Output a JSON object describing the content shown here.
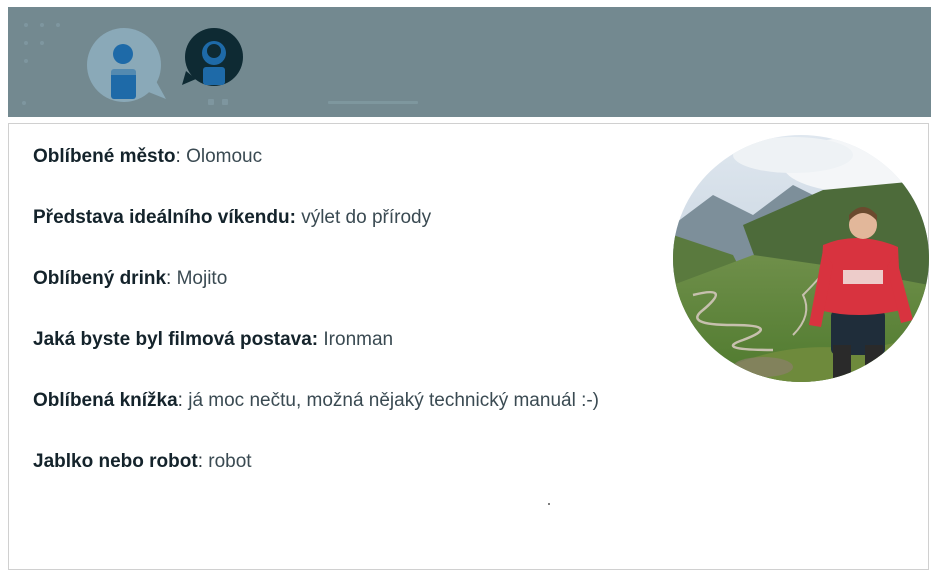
{
  "header": {
    "logo_icon": "chat-bubbles-person-icon",
    "colors": {
      "band": "#738990",
      "bubble_light": "#8aa9b8",
      "bubble_dark": "#0e2a33",
      "accent_blue": "#1e6aa8"
    }
  },
  "profile": {
    "facts": [
      {
        "label": "Oblíbené město",
        "sep": ": ",
        "value": "Olomouc"
      },
      {
        "label": "Představa ideálního víkendu:",
        "sep": " ",
        "value": "výlet do přírody"
      },
      {
        "label": "Oblíbený drink",
        "sep": ": ",
        "value": "Mojito"
      },
      {
        "label": "Jaká byste byl filmová postava:",
        "sep": " ",
        "value": "Ironman"
      },
      {
        "label": "Oblíbená knížka",
        "sep": ": ",
        "value": "já moc nečtu, možná nějaký technický manuál :-)"
      },
      {
        "label": "Jablko nebo robot",
        "sep": ": ",
        "value": "robot"
      }
    ],
    "photo_icon": "profile-photo"
  }
}
